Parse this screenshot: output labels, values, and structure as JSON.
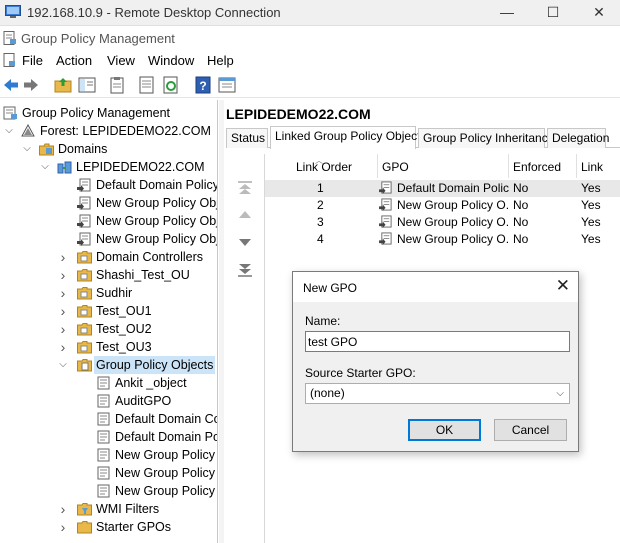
{
  "rdp": {
    "title": "192.168.10.9 - Remote Desktop Connection",
    "controls": {
      "minimize": "—",
      "maximize": "☐",
      "close": "✕"
    }
  },
  "mmc": {
    "title": "Group Policy Management"
  },
  "menu": {
    "items": [
      "File",
      "Action",
      "View",
      "Window",
      "Help"
    ]
  },
  "toolbar": {
    "buttons": [
      "back-icon",
      "forward-icon",
      "up-folder-icon",
      "show-hide-tree-icon",
      "clipboard-icon",
      "export-list-icon",
      "refresh-icon",
      "help-icon",
      "properties-icon"
    ]
  },
  "tree": {
    "items": [
      {
        "label": "Group Policy Management",
        "expander": "",
        "icon": "gpm-icon"
      },
      {
        "label": "Forest: LEPIDEDEMO22.COM",
        "expander": "v",
        "icon": "forest-icon"
      },
      {
        "label": "Domains",
        "expander": "v",
        "icon": "domains-icon"
      },
      {
        "label": "LEPIDEDEMO22.COM",
        "expander": "v",
        "icon": "domain-icon"
      },
      {
        "label": "Default Domain Policy",
        "expander": "",
        "icon": "gpo-link-icon"
      },
      {
        "label": "New Group Policy Obj",
        "expander": "",
        "icon": "gpo-link-icon"
      },
      {
        "label": "New Group Policy Obj",
        "expander": "",
        "icon": "gpo-link-icon"
      },
      {
        "label": "New Group Policy Obj",
        "expander": "",
        "icon": "gpo-link-icon"
      },
      {
        "label": "Domain Controllers",
        "expander": ">",
        "icon": "ou-folder-icon"
      },
      {
        "label": "Shashi_Test_OU",
        "expander": ">",
        "icon": "ou-folder-icon"
      },
      {
        "label": "Sudhir",
        "expander": ">",
        "icon": "ou-folder-icon"
      },
      {
        "label": "Test_OU1",
        "expander": ">",
        "icon": "ou-folder-icon"
      },
      {
        "label": "Test_OU2",
        "expander": ">",
        "icon": "ou-folder-icon"
      },
      {
        "label": "Test_OU3",
        "expander": ">",
        "icon": "ou-folder-icon"
      },
      {
        "label": "Group Policy Objects",
        "expander": "v",
        "icon": "gpo-folder-icon",
        "selected": true
      },
      {
        "label": "Ankit _object",
        "expander": "",
        "icon": "gpo-icon"
      },
      {
        "label": "AuditGPO",
        "expander": "",
        "icon": "gpo-icon"
      },
      {
        "label": "Default Domain Co",
        "expander": "",
        "icon": "gpo-icon"
      },
      {
        "label": "Default Domain Po",
        "expander": "",
        "icon": "gpo-icon"
      },
      {
        "label": "New Group Policy",
        "expander": "",
        "icon": "gpo-icon"
      },
      {
        "label": "New Group Policy",
        "expander": "",
        "icon": "gpo-icon"
      },
      {
        "label": "New Group Policy",
        "expander": "",
        "icon": "gpo-icon"
      },
      {
        "label": "WMI Filters",
        "expander": ">",
        "icon": "wmi-folder-icon"
      },
      {
        "label": "Starter GPOs",
        "expander": ">",
        "icon": "starter-folder-icon"
      }
    ]
  },
  "content": {
    "heading": "LEPIDEDEMO22.COM",
    "tabs": [
      "Status",
      "Linked Group Policy Objects",
      "Group Policy Inheritance",
      "Delegation"
    ],
    "active_tab": "Linked Group Policy Objects",
    "columns": [
      "Link Order",
      "GPO",
      "Enforced",
      "Link"
    ],
    "rows": [
      {
        "order": "1",
        "gpo": "Default Domain Policy",
        "enforced": "No",
        "link": "Yes"
      },
      {
        "order": "2",
        "gpo": "New Group Policy O...",
        "enforced": "No",
        "link": "Yes"
      },
      {
        "order": "3",
        "gpo": "New Group Policy O...",
        "enforced": "No",
        "link": "Yes"
      },
      {
        "order": "4",
        "gpo": "New Group Policy O...",
        "enforced": "No",
        "link": "Yes"
      }
    ],
    "order_buttons": [
      "move-top-icon",
      "move-up-icon",
      "move-down-icon",
      "move-bottom-icon"
    ]
  },
  "dialog": {
    "title": "New GPO",
    "close": "✕",
    "name_label": "Name:",
    "name_value": "test GPO",
    "starter_label": "Source Starter GPO:",
    "starter_value": "(none)",
    "ok_label": "OK",
    "cancel_label": "Cancel"
  },
  "colors": {
    "selection": "#cce4f7",
    "default_button_border": "#0078d7",
    "folder": "#e8b84a"
  }
}
